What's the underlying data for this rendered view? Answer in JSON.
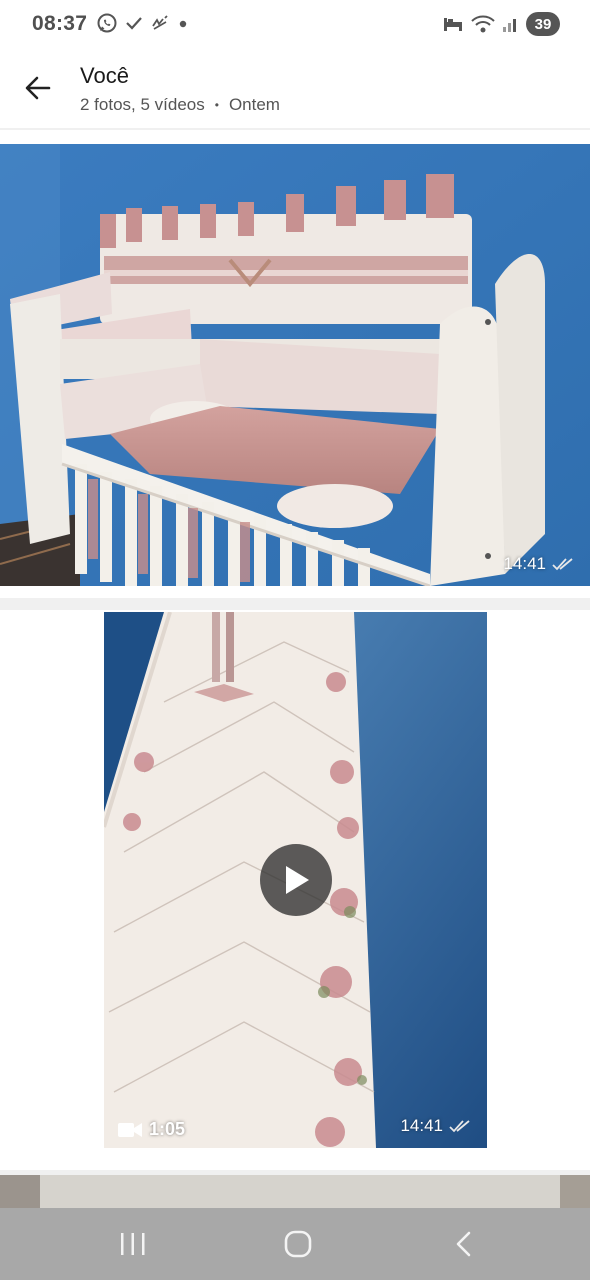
{
  "status_bar": {
    "time": "08:37",
    "battery": "39",
    "left_icons": [
      "whatsapp-icon",
      "check-icon",
      "missed-call-icon",
      "dot-icon"
    ],
    "right_icons": [
      "bed-icon",
      "wifi-icon",
      "signal-icon",
      "battery-icon"
    ]
  },
  "header": {
    "title": "Você",
    "subtitle_count": "2 fotos, 5 vídeos",
    "subtitle_date": "Ontem"
  },
  "media": [
    {
      "type": "photo",
      "time": "14:41",
      "status": "read-double-check"
    },
    {
      "type": "video",
      "time": "14:41",
      "duration": "1:05",
      "status": "read-double-check"
    },
    {
      "type": "photo"
    }
  ],
  "colors": {
    "tick_color": "#e8e8e8",
    "nav_bar_bg": "#a8a8a8",
    "crib_bedding_pink": "#c99a98",
    "wall_blue": "#3d7fbd",
    "blanket_blue": "#2f6aa8"
  },
  "nav_bar": {
    "items": [
      "recent-apps",
      "home",
      "back"
    ]
  }
}
